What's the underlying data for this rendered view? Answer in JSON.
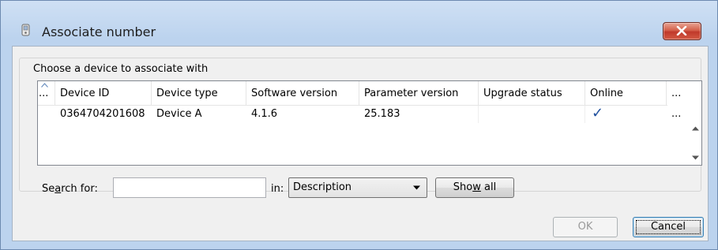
{
  "window": {
    "title": "Associate number",
    "close_icon": "close-x-icon"
  },
  "group": {
    "legend": "Choose a device to associate with"
  },
  "grid": {
    "columns": [
      {
        "label": "..."
      },
      {
        "label": "Device ID"
      },
      {
        "label": "Device type"
      },
      {
        "label": "Software version"
      },
      {
        "label": "Parameter version"
      },
      {
        "label": "Upgrade status"
      },
      {
        "label": "Online"
      },
      {
        "label": "..."
      }
    ],
    "rows": [
      {
        "device_id": "0364704201608",
        "device_type": "Device A",
        "software_version": "4.1.6",
        "parameter_version": "25.183",
        "upgrade_status": "",
        "online": "✓",
        "more": "..."
      }
    ]
  },
  "search": {
    "label_pre": "Se",
    "label_accel": "a",
    "label_post": "rch for:",
    "value": "",
    "in_label": "in:",
    "field_selected": "Description",
    "show_all_pre": "Sho",
    "show_all_accel": "w",
    "show_all_post": " all"
  },
  "buttons": {
    "ok": "OK",
    "cancel": "Cancel"
  },
  "colors": {
    "window_frame": "#bcd3ee",
    "close_button": "#c0392b",
    "check_mark": "#1f4f9e"
  }
}
